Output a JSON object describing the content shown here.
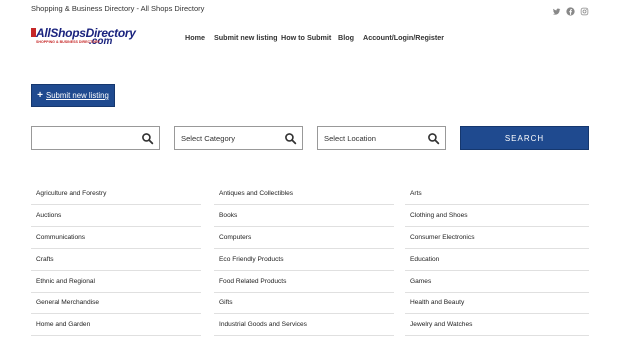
{
  "topbar": {
    "tagline": "Shopping & Business Directory - All Shops Directory",
    "social": [
      "twitter-icon",
      "facebook-icon",
      "instagram-icon"
    ]
  },
  "logo": {
    "brand": "AllShopsDirectory",
    "tld": ".com",
    "subtitle": "SHOPPING & BUSINESS DIRECTORY"
  },
  "nav": {
    "items": [
      "Home",
      "Submit new listing",
      "How to Submit",
      "Blog",
      "Account/Login/Register"
    ]
  },
  "submit_button": {
    "label": "Submit new listing"
  },
  "search": {
    "keyword_value": "",
    "category_placeholder": "Select Category",
    "location_placeholder": "Select Location",
    "button_label": "SEARCH"
  },
  "categories": {
    "columns": [
      [
        "Agriculture and Forestry",
        "Auctions",
        "Communications",
        "Crafts",
        "Ethnic and Regional",
        "General Merchandise",
        "Home and Garden"
      ],
      [
        "Antiques and Collectibles",
        "Books",
        "Computers",
        "Eco Friendly Products",
        "Food Related Products",
        "Gifts",
        "Industrial Goods and Services"
      ],
      [
        "Arts",
        "Clothing and Shoes",
        "Consumer Electronics",
        "Education",
        "Games",
        "Health and Beauty",
        "Jewelry and Watches"
      ]
    ]
  },
  "colors": {
    "primary": "#1f4a8f",
    "logo_blue": "#1a237e",
    "logo_red": "#c62828"
  }
}
